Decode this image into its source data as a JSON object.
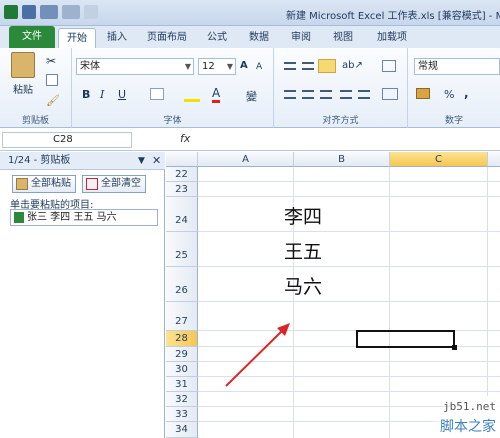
{
  "title": "新建 Microsoft Excel 工作表.xls [兼容模式] - Mic",
  "tabs": {
    "file": "文件",
    "home": "开始",
    "insert": "插入",
    "layout": "页面布局",
    "formula": "公式",
    "data": "数据",
    "review": "审阅",
    "view": "视图",
    "addins": "加载项"
  },
  "clipboard_group": {
    "paste": "粘贴",
    "label": "剪贴板"
  },
  "font_group": {
    "font": "宋体",
    "size": "12",
    "bold": "B",
    "italic": "I",
    "underline": "U",
    "font_color": "A",
    "label": "字体",
    "phonetic": "變"
  },
  "align_group": {
    "label": "对齐方式"
  },
  "number_group": {
    "format": "常规",
    "label": "数字",
    "percent": "%",
    "comma": ","
  },
  "namebox": "C28",
  "fx": "fx",
  "pane": {
    "header": "1/24 - 剪贴板",
    "paste_all": "全部粘贴",
    "clear_all": "全部清空",
    "prompt": "单击要粘贴的项目:",
    "item": "张三 李四 王五 马六"
  },
  "columns": [
    "A",
    "B",
    "C"
  ],
  "rows": [
    "22",
    "23",
    "24",
    "25",
    "26",
    "27",
    "28",
    "29",
    "30",
    "31",
    "32",
    "33",
    "34"
  ],
  "cells": {
    "b24": "李四",
    "b25": "王五",
    "b26": "马六"
  },
  "watermark": {
    "site": "jb51.net",
    "name": "脚本之家"
  },
  "colors": {
    "file_tab": "#2a8a3a",
    "selection_header": "#f6c653",
    "arrow": "#d92626"
  }
}
